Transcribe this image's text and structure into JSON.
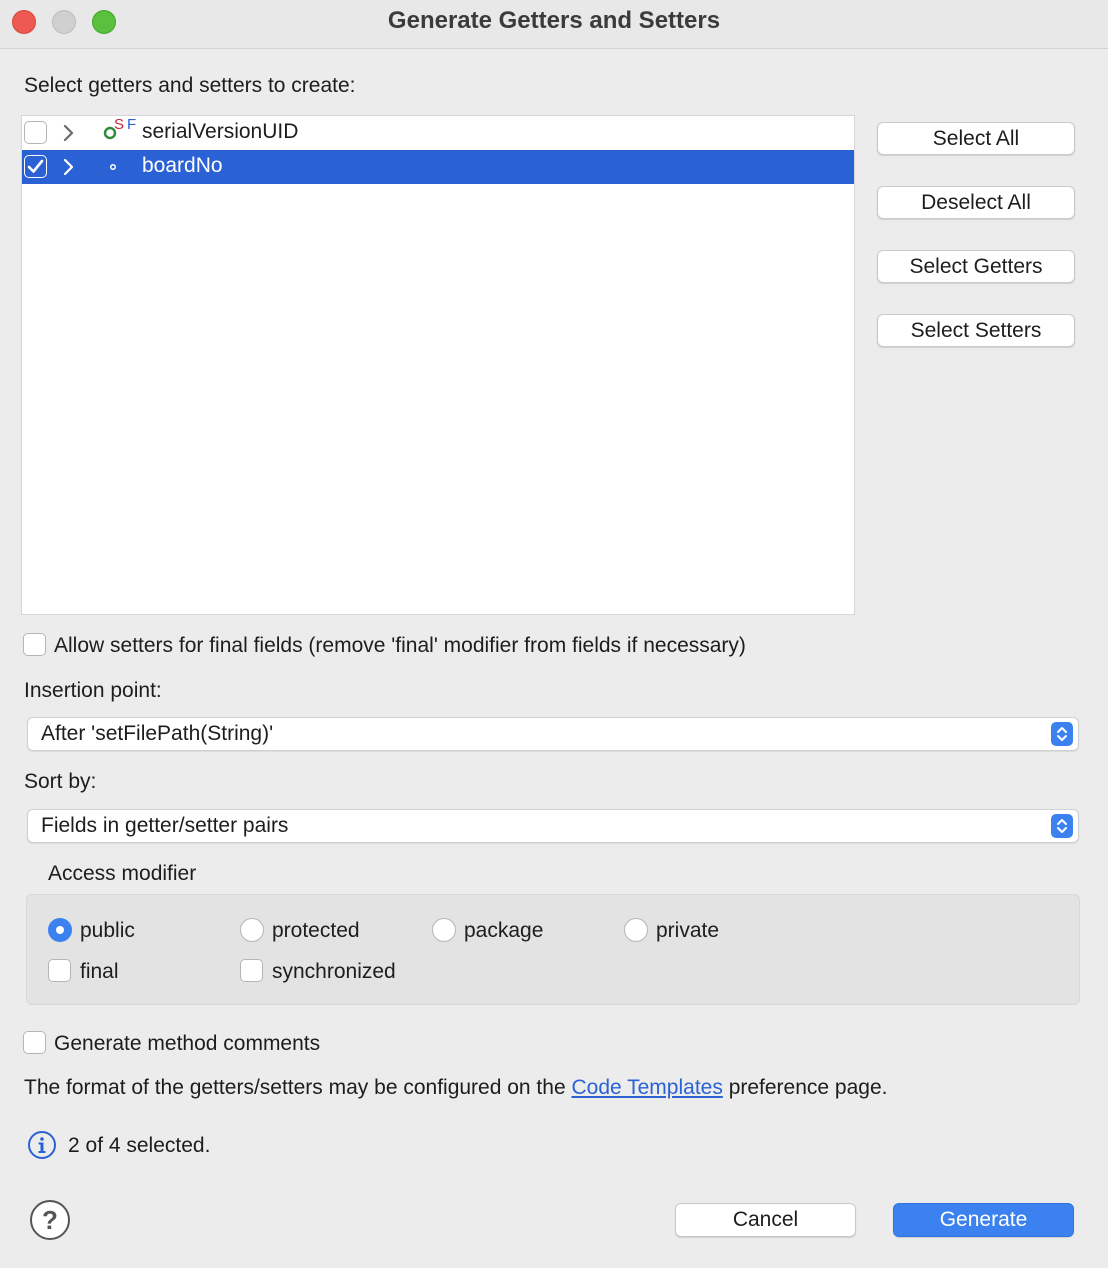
{
  "window": {
    "title": "Generate Getters and Setters"
  },
  "main": {
    "select_label": "Select getters and setters to create:",
    "tree": [
      {
        "name": "serialVersionUID",
        "checked": false,
        "badge": "S F",
        "icon": "static-final-field-icon"
      },
      {
        "name": "boardNo",
        "checked": true,
        "selected": true,
        "icon": "private-field-icon"
      }
    ],
    "side_buttons": {
      "select_all": "Select All",
      "deselect_all": "Deselect All",
      "select_getters": "Select Getters",
      "select_setters": "Select Setters"
    },
    "allow_final_label": "Allow setters for final fields (remove 'final' modifier from fields if necessary)",
    "insertion_label": "Insertion point:",
    "insertion_value": "After 'setFilePath(String)'",
    "sort_label": "Sort by:",
    "sort_value": "Fields in getter/setter pairs",
    "access": {
      "title": "Access modifier",
      "public": "public",
      "protected": "protected",
      "package": "package",
      "private": "private",
      "final": "final",
      "synchronized": "synchronized",
      "selected": "public"
    },
    "comments_label": "Generate method comments",
    "format_prefix": "The format of the getters/setters may be configured on the",
    "format_link": "Code Templates",
    "format_suffix": "preference page.",
    "status": "2 of 4 selected."
  },
  "footer": {
    "cancel": "Cancel",
    "generate": "Generate"
  },
  "colors": {
    "accent": "#3b82f0",
    "selection": "#2a62d6",
    "link": "#2a62d6"
  }
}
